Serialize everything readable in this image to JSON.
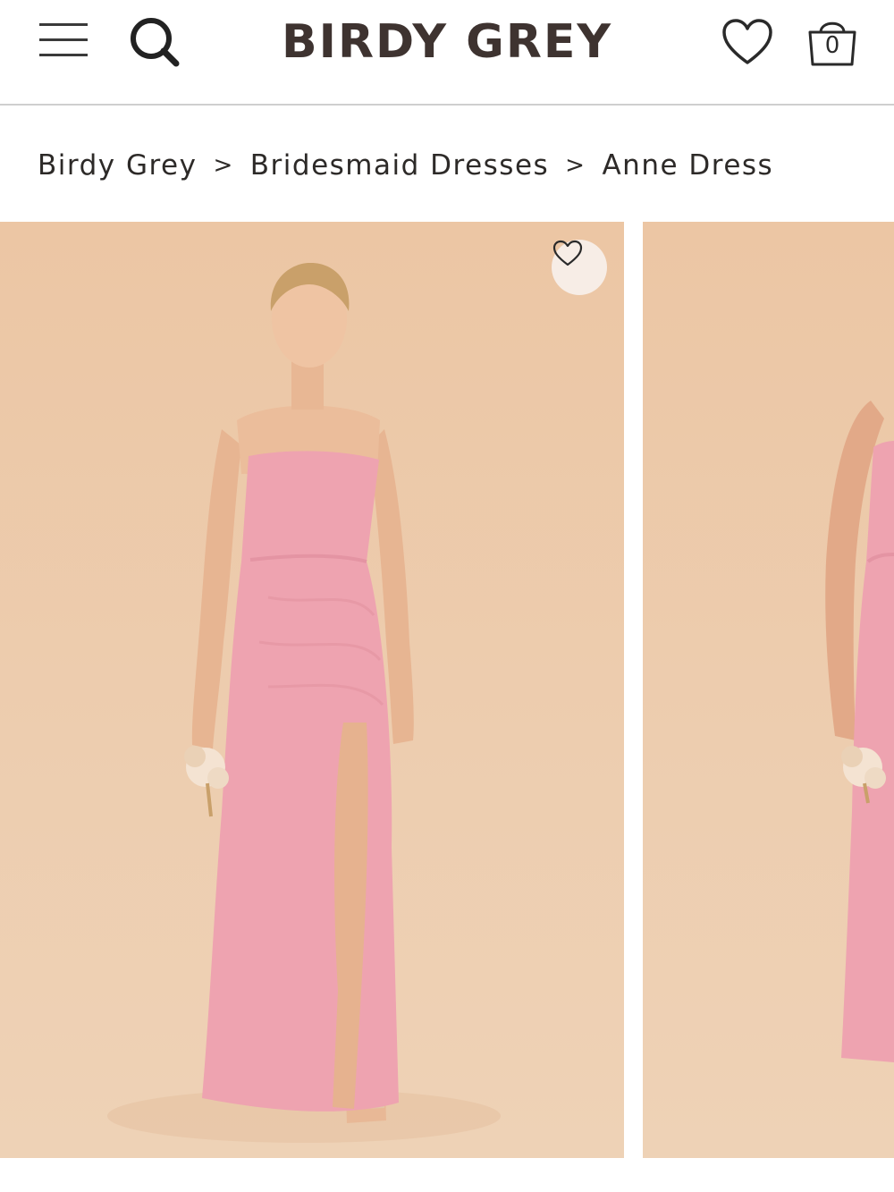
{
  "header": {
    "logo": "BIRDY GREY",
    "bag_count": "0",
    "icons": {
      "menu": "hamburger-menu-icon",
      "search": "search-icon",
      "wishlist": "heart-icon",
      "bag": "shopping-bag-icon"
    }
  },
  "breadcrumb": {
    "items": [
      "Birdy Grey",
      "Bridesmaid Dresses",
      "Anne Dress"
    ],
    "separator": ">"
  },
  "gallery": {
    "images": [
      {
        "subject": "model-in-pink-strapless-satin-dress-front"
      },
      {
        "subject": "model-in-pink-strapless-satin-dress-side"
      }
    ],
    "favorite_icon": "heart-icon"
  },
  "colors": {
    "brand_text": "#3e3330",
    "photo_background": "#ecc6a4",
    "dress_pink": "#eea3b0",
    "divider": "#cfcfcf"
  }
}
